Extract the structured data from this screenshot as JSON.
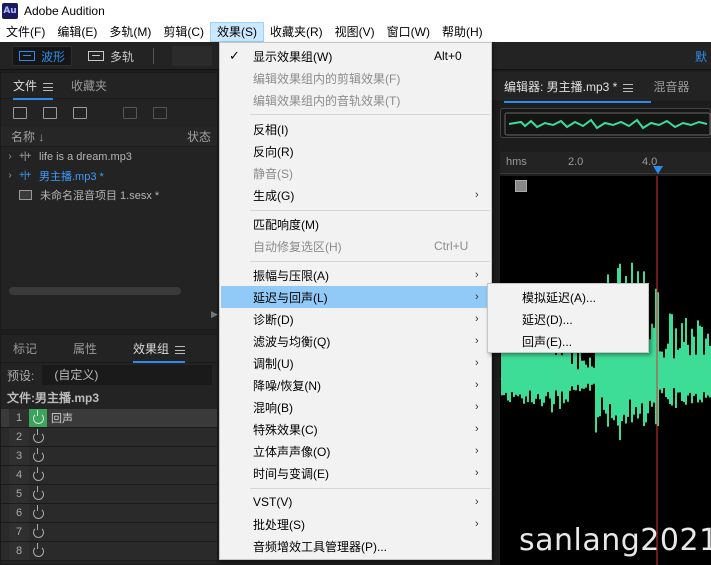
{
  "app": {
    "logo": "Au",
    "title": "Adobe Audition"
  },
  "menubar": [
    "文件(F)",
    "编辑(E)",
    "多轨(M)",
    "剪辑(C)",
    "效果(S)",
    "收藏夹(R)",
    "视图(V)",
    "窗口(W)",
    "帮助(H)"
  ],
  "toolbar": {
    "waveform_label": "波形",
    "multitrack_label": "多轨",
    "right_label": "默"
  },
  "files_panel": {
    "tabs": [
      "文件",
      "收藏夹"
    ],
    "header_name": "名称",
    "header_status": "状态",
    "files": [
      {
        "name": "life is a dream.mp3",
        "current": false
      },
      {
        "name": "男主播.mp3 *",
        "current": true
      },
      {
        "name": "未命名混音项目 1.sesx *",
        "current": false
      }
    ]
  },
  "fx_panel": {
    "tabs": [
      "标记",
      "属性",
      "效果组"
    ],
    "preset_label": "预设:",
    "preset_value": "(自定义)",
    "file_label": "文件:男主播.mp3",
    "slots": [
      {
        "num": "1",
        "name": "回声",
        "on": true
      },
      {
        "num": "2",
        "name": "",
        "on": false
      },
      {
        "num": "3",
        "name": "",
        "on": false
      },
      {
        "num": "4",
        "name": "",
        "on": false
      },
      {
        "num": "5",
        "name": "",
        "on": false
      },
      {
        "num": "6",
        "name": "",
        "on": false
      },
      {
        "num": "7",
        "name": "",
        "on": false
      },
      {
        "num": "8",
        "name": "",
        "on": false
      }
    ]
  },
  "editor": {
    "tabs": [
      "编辑器: 男主播.mp3 *",
      "混音器"
    ],
    "timeline": [
      "hms",
      "2.0",
      "4.0"
    ],
    "waveform_color": "#3ddc97",
    "playhead_color": "#e03030"
  },
  "effects_menu": {
    "items": [
      {
        "label": "显示效果组(W)",
        "shortcut": "Alt+0",
        "checked": true
      },
      {
        "label": "编辑效果组内的剪辑效果(F)",
        "disabled": true
      },
      {
        "label": "编辑效果组内的音轨效果(T)",
        "disabled": true
      },
      {
        "label": "反相(I)"
      },
      {
        "label": "反向(R)"
      },
      {
        "label": "静音(S)",
        "disabled": true
      },
      {
        "label": "生成(G)",
        "submenu": true
      },
      {
        "label": "匹配响度(M)"
      },
      {
        "label": "自动修复选区(H)",
        "shortcut": "Ctrl+U",
        "disabled": true
      },
      {
        "label": "振幅与压限(A)",
        "submenu": true
      },
      {
        "label": "延迟与回声(L)",
        "submenu": true,
        "hover": true
      },
      {
        "label": "诊断(D)",
        "submenu": true
      },
      {
        "label": "滤波与均衡(Q)",
        "submenu": true
      },
      {
        "label": "调制(U)",
        "submenu": true
      },
      {
        "label": "降噪/恢复(N)",
        "submenu": true
      },
      {
        "label": "混响(B)",
        "submenu": true
      },
      {
        "label": "特殊效果(C)",
        "submenu": true
      },
      {
        "label": "立体声声像(O)",
        "submenu": true
      },
      {
        "label": "时间与变调(E)",
        "submenu": true
      },
      {
        "label": "VST(V)",
        "submenu": true
      },
      {
        "label": "批处理(S)",
        "submenu": true
      },
      {
        "label": "音频增效工具管理器(P)..."
      }
    ],
    "submenu_items": [
      "模拟延迟(A)...",
      "延迟(D)...",
      "回声(E)..."
    ]
  },
  "watermark": "sanlang2021"
}
